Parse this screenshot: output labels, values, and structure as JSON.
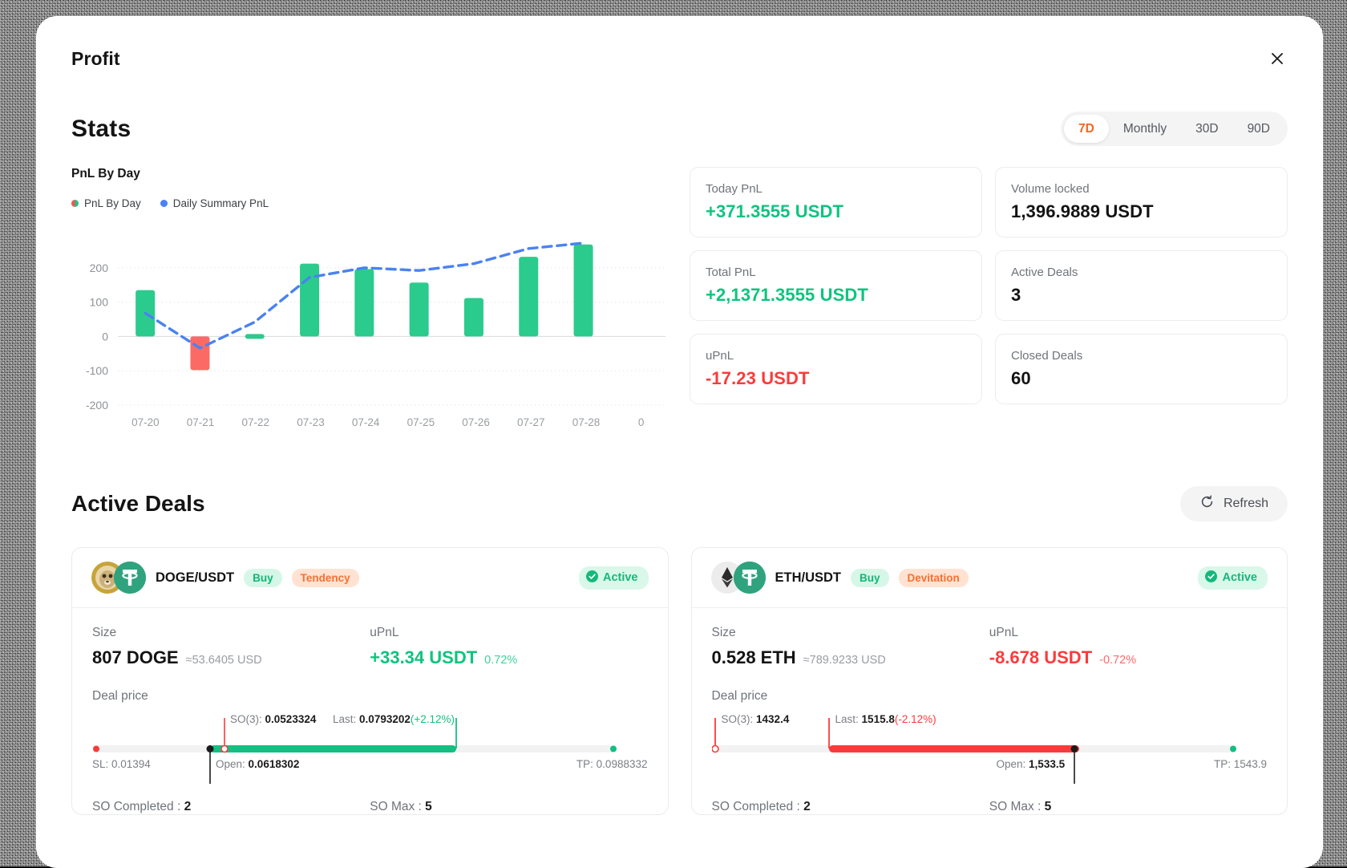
{
  "modal": {
    "title": "Profit",
    "close_icon": "close-icon"
  },
  "stats": {
    "heading": "Stats",
    "periods": [
      {
        "label": "7D",
        "active": true
      },
      {
        "label": "Monthly",
        "active": false
      },
      {
        "label": "30D",
        "active": false
      },
      {
        "label": "90D",
        "active": false
      }
    ],
    "chart_title": "PnL By Day",
    "legend": [
      {
        "label": "PnL By Day",
        "swatch": "split"
      },
      {
        "label": "Daily Summary PnL",
        "swatch": "blue"
      }
    ],
    "cards": [
      {
        "label": "Today PnL",
        "value": "+371.3555 USDT",
        "tone": "pos"
      },
      {
        "label": "Volume locked",
        "value": "1,396.9889 USDT",
        "tone": "neutral"
      },
      {
        "label": "Total PnL",
        "value": "+2,1371.3555 USDT",
        "tone": "pos"
      },
      {
        "label": "Active Deals",
        "value": "3",
        "tone": "neutral"
      },
      {
        "label": "uPnL",
        "value": "-17.23 USDT",
        "tone": "neg"
      },
      {
        "label": "Closed Deals",
        "value": "60",
        "tone": "neutral"
      }
    ]
  },
  "chart_data": {
    "type": "bar",
    "title": "PnL By Day",
    "xlabel": "",
    "ylabel": "",
    "ylim": [
      -200,
      300
    ],
    "yticks": [
      200,
      100,
      0,
      -100,
      -200
    ],
    "ytick_labels": [
      "200",
      "100",
      "0",
      "-100",
      "-200"
    ],
    "categories": [
      "07-20",
      "07-21",
      "07-22",
      "07-23",
      "07-24",
      "07-25",
      "07-26",
      "07-27",
      "07-28",
      "0"
    ],
    "grid": true,
    "legend_position": "top-left",
    "series": [
      {
        "name": "PnL By Day",
        "type": "bar",
        "values": [
          135,
          -98,
          3,
          212,
          196,
          157,
          112,
          232,
          268,
          null
        ],
        "color_positive": "#2bcb8d",
        "color_negative": "#fb6a64",
        "color_zero": "#b3b3b3"
      },
      {
        "name": "Daily Summary PnL",
        "type": "line",
        "style": "dashed",
        "values": [
          68,
          -34,
          42,
          172,
          200,
          192,
          212,
          256,
          272,
          null
        ],
        "color": "#4a82f0"
      }
    ]
  },
  "deals": {
    "heading": "Active Deals",
    "refresh_label": "Refresh",
    "refresh_icon": "refresh-icon",
    "items": [
      {
        "pair": "DOGE/USDT",
        "base_icon": "doge-icon",
        "quote_icon": "tether-icon",
        "side": "Buy",
        "strategy": "Tendency",
        "status": "Active",
        "size_label": "Size",
        "size_value": "807 DOGE",
        "size_approx": "≈53.6405 USD",
        "upnl_label": "uPnL",
        "upnl_value": "+33.34 USDT",
        "upnl_pct": "0.72%",
        "upnl_tone": "pos",
        "deal_price_label": "Deal price",
        "sl": "SL: 0.01394",
        "so": "SO(3):",
        "so_value": "0.0523324",
        "last": "Last:",
        "last_value": "0.0793202",
        "last_pct": "(+2.12%)",
        "open": "Open:",
        "open_value": "0.0618302",
        "tp": "TP: 0.0988332",
        "so_completed_label": "SO Completed :",
        "so_completed_value": "2",
        "so_max_label": "SO Max :",
        "so_max_value": "5",
        "tone": "pos"
      },
      {
        "pair": "ETH/USDT",
        "base_icon": "ethereum-icon",
        "quote_icon": "tether-icon",
        "side": "Buy",
        "strategy": "Devitation",
        "status": "Active",
        "size_label": "Size",
        "size_value": "0.528 ETH",
        "size_approx": "≈789.9233 USD",
        "upnl_label": "uPnL",
        "upnl_value": "-8.678 USDT",
        "upnl_pct": "-0.72%",
        "upnl_tone": "neg",
        "deal_price_label": "Deal price",
        "sl": "",
        "so": "SO(3):",
        "so_value": "1432.4",
        "last": "Last:",
        "last_value": "1515.8",
        "last_pct": "(-2.12%)",
        "open": "Open:",
        "open_value": "1,533.5",
        "tp": "TP: 1543.9",
        "so_completed_label": "SO Completed :",
        "so_completed_value": "2",
        "so_max_label": "SO Max :",
        "so_max_value": "5",
        "tone": "neg"
      }
    ]
  },
  "colors": {
    "accent": "#f26722",
    "positive": "#0ec47f",
    "negative": "#fb3b3b",
    "line": "#4a82f0"
  }
}
